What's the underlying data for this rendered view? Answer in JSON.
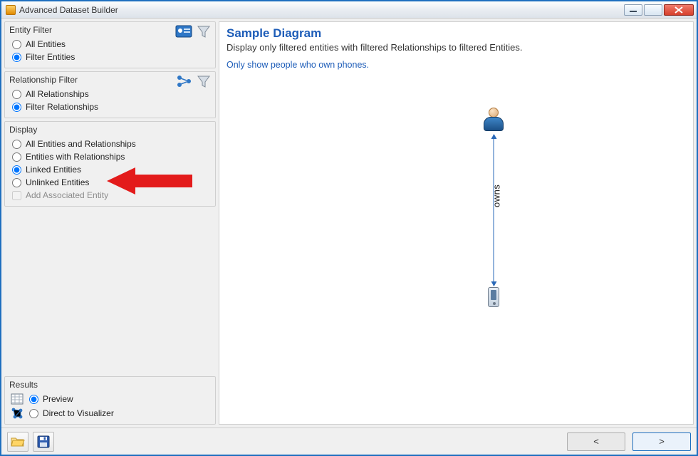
{
  "window": {
    "title": "Advanced Dataset Builder"
  },
  "entity_filter": {
    "header": "Entity Filter",
    "opt_all": "All Entities",
    "opt_filter": "Filter Entities",
    "selected": "filter"
  },
  "relationship_filter": {
    "header": "Relationship Filter",
    "opt_all": "All Relationships",
    "opt_filter": "Filter Relationships",
    "selected": "filter"
  },
  "display": {
    "header": "Display",
    "opt_all": "All Entities and Relationships",
    "opt_with_rel": "Entities with Relationships",
    "opt_linked": "Linked Entities",
    "opt_unlinked": "Unlinked Entities",
    "chk_assoc": "Add Associated Entity",
    "selected": "linked"
  },
  "results": {
    "header": "Results",
    "opt_preview": "Preview",
    "opt_direct": "Direct to Visualizer",
    "selected": "preview"
  },
  "preview": {
    "title": "Sample Diagram",
    "subtitle": "Display only filtered entities with filtered Relationships to filtered Entities.",
    "hint": "Only show people who own phones.",
    "edge_label": "owns"
  },
  "nav": {
    "back": "<",
    "next": ">"
  }
}
